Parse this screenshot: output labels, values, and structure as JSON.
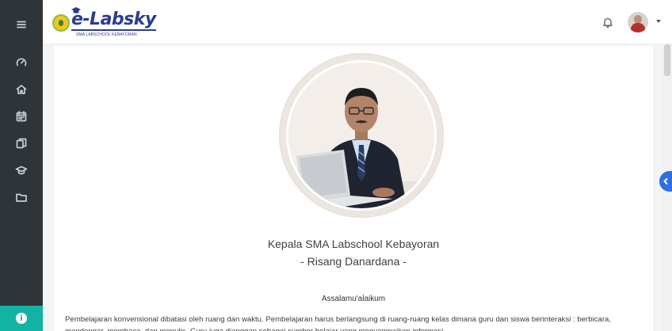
{
  "app": {
    "logo_text": "e-Labsky",
    "logo_subtitle": "SMA LABSCHOOL KEBAYORAN"
  },
  "sidebar": {
    "items": [
      {
        "icon": "menu-icon"
      },
      {
        "icon": "dashboard-gauge-icon"
      },
      {
        "icon": "home-icon"
      },
      {
        "icon": "calendar-icon"
      },
      {
        "icon": "copy-files-icon"
      },
      {
        "icon": "graduation-cap-icon"
      },
      {
        "icon": "folder-icon"
      }
    ],
    "help_icon": "help-info-icon",
    "help_glyph": "i"
  },
  "header": {
    "notification_icon": "bell-icon",
    "user_avatar": "user-avatar"
  },
  "main": {
    "principal_title": "Kepala SMA Labschool Kebayoran",
    "principal_name": "- Risang Danardana -",
    "greeting": "Assalamu'alaikum",
    "paragraph": "Pembelajaran konvensional dibatasi oleh ruang dan waktu. Pembelajaran harus berlangsung di ruang-ruang kelas dimana guru dan siswa berinteraksi : berbicara, mendengar, membaca, dan menulis. Guru juga dianggap sebagai sumber belajar yang menyampaikan informasi"
  },
  "colors": {
    "sidebar_bg": "#2f3438",
    "accent_teal": "#13b3a3",
    "accent_blue": "#2f6fe4",
    "logo_blue": "#2a3c8e"
  }
}
